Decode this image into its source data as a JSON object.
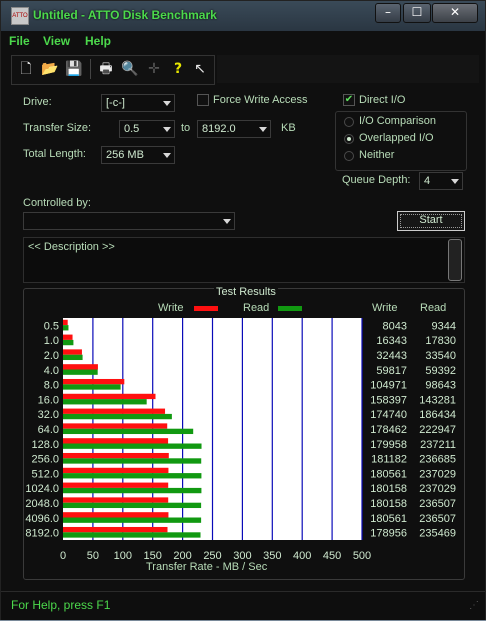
{
  "window": {
    "title": "Untitled - ATTO Disk Benchmark",
    "icon_text": "ATTO"
  },
  "menu": {
    "file": "File",
    "view": "View",
    "help": "Help"
  },
  "toolbar": {
    "icons": [
      "new-file-icon",
      "open-folder-icon",
      "save-icon",
      "print-icon",
      "print-preview-icon",
      "crosshair-icon",
      "help-icon",
      "context-help-icon"
    ]
  },
  "form": {
    "drive_label": "Drive:",
    "drive_value": "[-c-]",
    "force_write_label": "Force Write Access",
    "direct_io_label": "Direct I/O",
    "transfer_size_label": "Transfer Size:",
    "transfer_from": "0.5",
    "to_label": "to",
    "transfer_to": "8192.0",
    "kb_label": "KB",
    "total_length_label": "Total Length:",
    "total_length_value": "256 MB",
    "io_comparison_label": "I/O Comparison",
    "overlapped_io_label": "Overlapped I/O",
    "neither_label": "Neither",
    "queue_depth_label": "Queue Depth:",
    "queue_depth_value": "4",
    "controlled_by_label": "Controlled by:",
    "controlled_by_value": "",
    "start_label": "Start",
    "description_text": "<< Description >>"
  },
  "colors": {
    "write": "#ff1010",
    "read": "#119911",
    "grid": "#0a0ab8",
    "accent": "#4cd94c"
  },
  "chart_data": {
    "type": "bar",
    "title": "Test Results",
    "xlabel": "Transfer Rate - MB / Sec",
    "xlim": [
      0,
      500
    ],
    "xticks": [
      0,
      50,
      100,
      150,
      200,
      250,
      300,
      350,
      400,
      450,
      500
    ],
    "categories": [
      "0.5",
      "1.0",
      "2.0",
      "4.0",
      "8.0",
      "16.0",
      "32.0",
      "64.0",
      "128.0",
      "256.0",
      "512.0",
      "1024.0",
      "2048.0",
      "4096.0",
      "8192.0"
    ],
    "series": [
      {
        "name": "Write",
        "color": "#ff1010",
        "values": [
          8043,
          16343,
          32443,
          59817,
          104971,
          158397,
          174740,
          178462,
          179958,
          181182,
          180561,
          180158,
          180158,
          180561,
          178956
        ]
      },
      {
        "name": "Read",
        "color": "#119911",
        "values": [
          9344,
          17830,
          33540,
          59392,
          98643,
          143281,
          186434,
          222947,
          237211,
          236685,
          237029,
          237029,
          236507,
          236507,
          235469
        ]
      }
    ],
    "table_headers": [
      "Write",
      "Read"
    ]
  },
  "status": {
    "text": "For Help, press F1"
  }
}
